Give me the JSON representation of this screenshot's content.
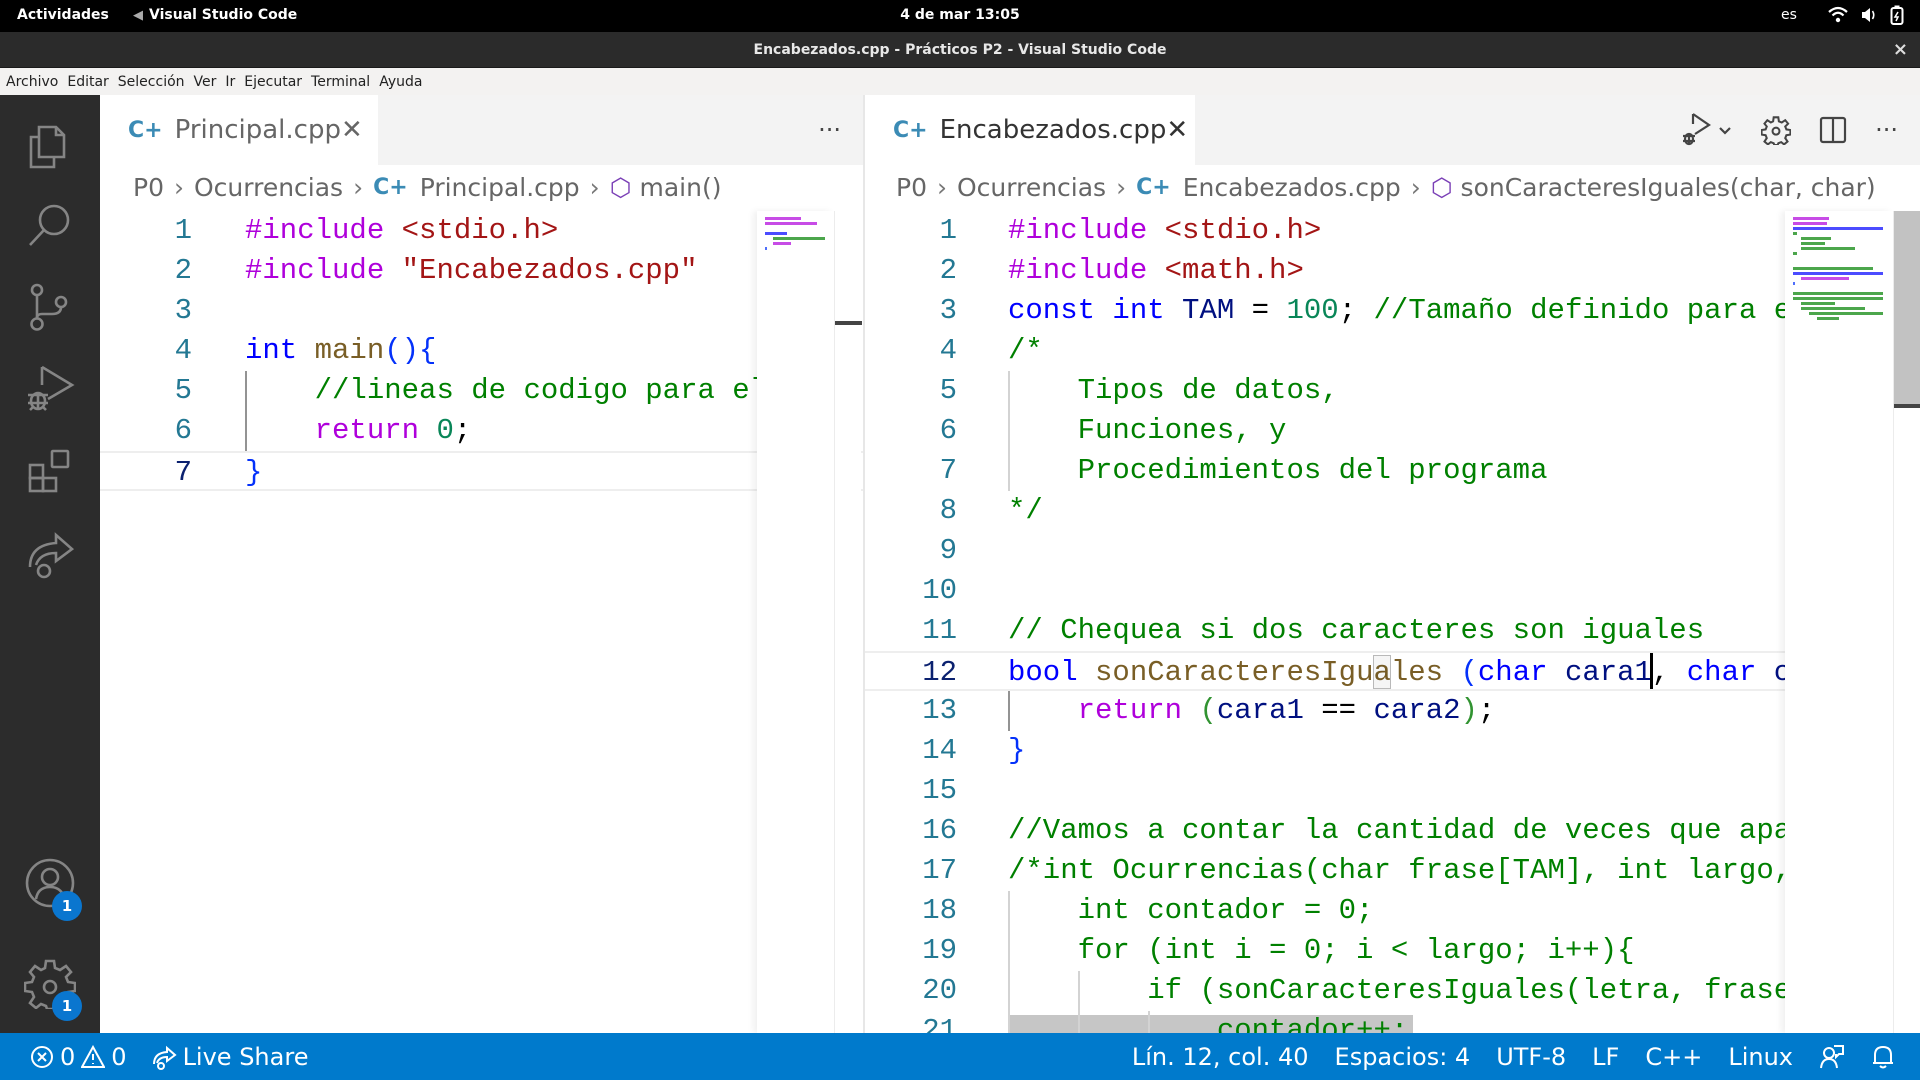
{
  "system_bar": {
    "activities": "Actividades",
    "app_name": "Visual Studio Code",
    "clock": "4 de mar  13:05",
    "language": "es"
  },
  "window": {
    "title": "Encabezados.cpp - Prácticos P2 - Visual Studio Code",
    "close": "×"
  },
  "menu": [
    "Archivo",
    "Editar",
    "Selección",
    "Ver",
    "Ir",
    "Ejecutar",
    "Terminal",
    "Ayuda"
  ],
  "activity_bar": {
    "items": [
      "explorer",
      "search",
      "source-control",
      "run-and-debug",
      "extensions",
      "live-share"
    ],
    "accounts_badge": "1",
    "manage_badge": "1"
  },
  "left_editor": {
    "tab": {
      "icon": "C+",
      "label": "Principal.cpp",
      "close": "✕"
    },
    "more_actions": "···",
    "breadcrumb": [
      "P0",
      "Ocurrencias",
      "Principal.cpp",
      "main()"
    ],
    "active_line": 7,
    "lines": [
      {
        "n": "1",
        "tokens": [
          [
            "pre",
            "#include"
          ],
          [
            "",
            " "
          ],
          [
            "str",
            "<stdio.h>"
          ]
        ]
      },
      {
        "n": "2",
        "tokens": [
          [
            "pre",
            "#include"
          ],
          [
            "",
            " "
          ],
          [
            "str",
            "\"Encabezados.cpp\""
          ]
        ]
      },
      {
        "n": "3",
        "tokens": []
      },
      {
        "n": "4",
        "tokens": [
          [
            "kw",
            "int"
          ],
          [
            "",
            " "
          ],
          [
            "fn",
            "main"
          ],
          [
            "br",
            "(){"
          ]
        ]
      },
      {
        "n": "5",
        "tokens": [
          [
            "",
            "    "
          ],
          [
            "com",
            "//lineas de codigo para el"
          ]
        ]
      },
      {
        "n": "6",
        "tokens": [
          [
            "",
            "    "
          ],
          [
            "ctl",
            "return"
          ],
          [
            "",
            " "
          ],
          [
            "num",
            "0"
          ],
          [
            "",
            ";"
          ]
        ]
      },
      {
        "n": "7",
        "tokens": [
          [
            "br",
            "}"
          ]
        ]
      }
    ]
  },
  "right_editor": {
    "tab": {
      "icon": "C+",
      "label": "Encabezados.cpp",
      "close": "✕"
    },
    "actions": [
      "run-debug",
      "settings",
      "split-editor",
      "more-actions"
    ],
    "breadcrumb": [
      "P0",
      "Ocurrencias",
      "Encabezados.cpp",
      "sonCaracteresIguales(char, char)"
    ],
    "active_line": 12,
    "lines": [
      {
        "n": "1",
        "tokens": [
          [
            "pre",
            "#include"
          ],
          [
            "",
            " "
          ],
          [
            "str",
            "<stdio.h>"
          ]
        ]
      },
      {
        "n": "2",
        "tokens": [
          [
            "pre",
            "#include"
          ],
          [
            "",
            " "
          ],
          [
            "str",
            "<math.h>"
          ]
        ]
      },
      {
        "n": "3",
        "tokens": [
          [
            "kw",
            "const"
          ],
          [
            "",
            " "
          ],
          [
            "kw",
            "int"
          ],
          [
            "",
            " "
          ],
          [
            "var",
            "TAM"
          ],
          [
            "",
            " = "
          ],
          [
            "num",
            "100"
          ],
          [
            "",
            "; "
          ],
          [
            "com",
            "//Tamaño definido para e"
          ]
        ]
      },
      {
        "n": "4",
        "tokens": [
          [
            "com",
            "/*"
          ]
        ]
      },
      {
        "n": "5",
        "tokens": [
          [
            "com",
            "    Tipos de datos,"
          ]
        ]
      },
      {
        "n": "6",
        "tokens": [
          [
            "com",
            "    Funciones, y"
          ]
        ]
      },
      {
        "n": "7",
        "tokens": [
          [
            "com",
            "    Procedimientos del programa"
          ]
        ]
      },
      {
        "n": "8",
        "tokens": [
          [
            "com",
            "*/"
          ]
        ]
      },
      {
        "n": "9",
        "tokens": []
      },
      {
        "n": "10",
        "tokens": []
      },
      {
        "n": "11",
        "tokens": [
          [
            "com",
            "// Chequea si dos caracteres son iguales"
          ]
        ]
      },
      {
        "n": "12",
        "tokens": [
          [
            "kw",
            "bool"
          ],
          [
            "",
            " "
          ],
          [
            "fn",
            "sonCaracteresIguales"
          ],
          [
            "",
            " "
          ],
          [
            "br",
            "("
          ],
          [
            "kw",
            "char"
          ],
          [
            "",
            " "
          ],
          [
            "var",
            "cara1"
          ],
          [
            "",
            ", "
          ],
          [
            "kw",
            "char"
          ],
          [
            "",
            " "
          ],
          [
            "var",
            "c"
          ]
        ]
      },
      {
        "n": "13",
        "tokens": [
          [
            "",
            "    "
          ],
          [
            "ctl",
            "return"
          ],
          [
            "",
            " "
          ],
          [
            "br2",
            "("
          ],
          [
            "var",
            "cara1"
          ],
          [
            "",
            " == "
          ],
          [
            "var",
            "cara2"
          ],
          [
            "br2",
            ")"
          ],
          [
            "",
            ";"
          ]
        ]
      },
      {
        "n": "14",
        "tokens": [
          [
            "br",
            "}"
          ]
        ]
      },
      {
        "n": "15",
        "tokens": []
      },
      {
        "n": "16",
        "tokens": [
          [
            "com",
            "//Vamos a contar la cantidad de veces que apa"
          ]
        ]
      },
      {
        "n": "17",
        "tokens": [
          [
            "com",
            "/*int Ocurrencias(char frase[TAM], int largo,"
          ]
        ]
      },
      {
        "n": "18",
        "tokens": [
          [
            "com",
            "    int contador = 0;"
          ]
        ]
      },
      {
        "n": "19",
        "tokens": [
          [
            "com",
            "    for (int i = 0; i < largo; i++){"
          ]
        ]
      },
      {
        "n": "20",
        "tokens": [
          [
            "com",
            "        if (sonCaracteresIguales(letra, frase"
          ]
        ]
      },
      {
        "n": "21",
        "tokens": [
          [
            "com",
            "            contador++;"
          ]
        ]
      }
    ]
  },
  "status_bar": {
    "errors": "0",
    "warnings": "0",
    "live_share": "Live Share",
    "position": "Lín. 12, col. 40",
    "spaces": "Espacios: 4",
    "encoding": "UTF-8",
    "eol": "LF",
    "language": "C++",
    "platform": "Linux"
  },
  "colors": {
    "status_bar": "#007acc",
    "activity_bar": "#2c2c2c",
    "badge": "#0a76cf",
    "line_number": "#237893",
    "keyword": "#0000ff",
    "preprocessor": "#af00db",
    "string": "#a31515",
    "comment": "#008000"
  }
}
